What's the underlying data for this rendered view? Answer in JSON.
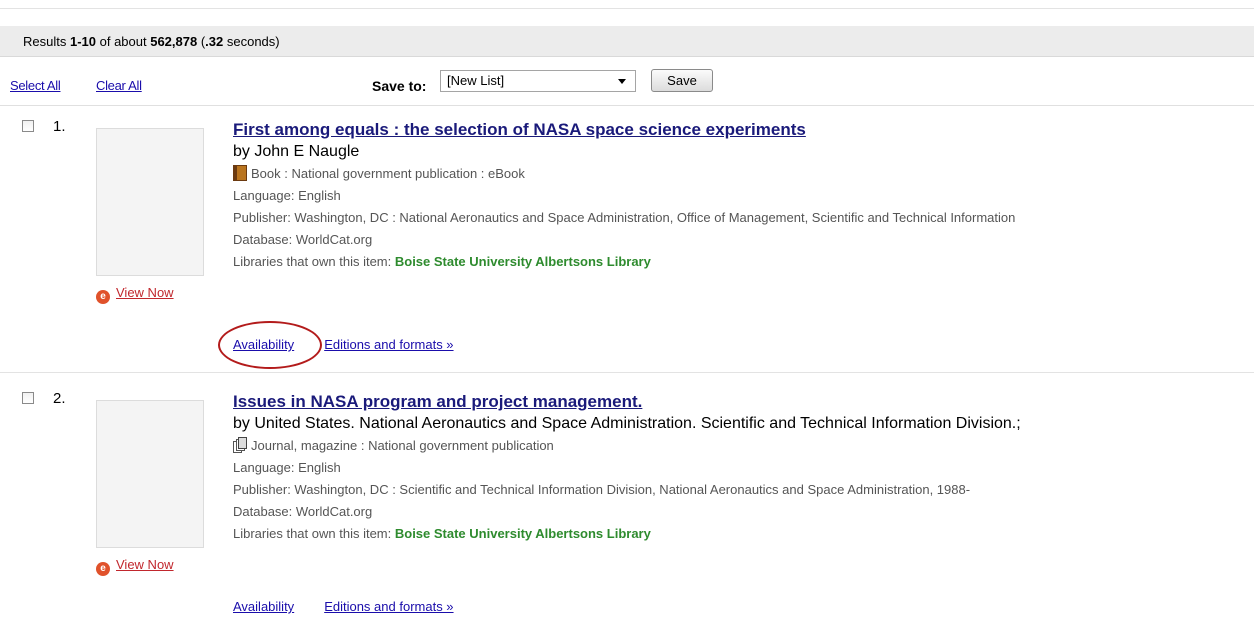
{
  "results": {
    "prefix": "Results ",
    "range": "1-10",
    "of": " of about ",
    "total": "562,878",
    "time_open": " (",
    "seconds": ".32",
    "time_close": " seconds)"
  },
  "controls": {
    "select_all": "Select All",
    "clear_all": "Clear All",
    "save_to_label": "Save to:",
    "save_to_selected": "[New List]",
    "save_button": "Save"
  },
  "records": [
    {
      "number": "1.",
      "title": "First among equals : the selection of NASA space science experiments",
      "author": "by John E Naugle",
      "format_icon": "book-icon",
      "format": "Book : National government publication : eBook",
      "language": "Language: English",
      "publisher": "Publisher: Washington, DC : National Aeronautics and Space Administration, Office of Management, Scientific and Technical Information",
      "database": "Database: WorldCat.org",
      "libraries_label": "Libraries that own this item: ",
      "library": "Boise State University Albertsons Library",
      "view_now": "View Now",
      "availability": "Availability",
      "editions": "Editions and formats »"
    },
    {
      "number": "2.",
      "title": "Issues in NASA program and project management.",
      "author": "by United States. National Aeronautics and Space Administration. Scientific and Technical Information Division.;",
      "format_icon": "journal-icon",
      "format": "Journal, magazine : National government publication",
      "language": "Language: English",
      "publisher": "Publisher: Washington, DC : Scientific and Technical Information Division, National Aeronautics and Space Administration, 1988-",
      "database": "Database: WorldCat.org",
      "libraries_label": "Libraries that own this item: ",
      "library": "Boise State University Albertsons Library",
      "view_now": "View Now",
      "availability": "Availability",
      "editions": "Editions and formats »"
    }
  ],
  "colors": {
    "link": "#1a0dab",
    "title": "#1a1a7a",
    "library_green": "#2e8b2e",
    "highlight_circle": "#b31b1b"
  }
}
